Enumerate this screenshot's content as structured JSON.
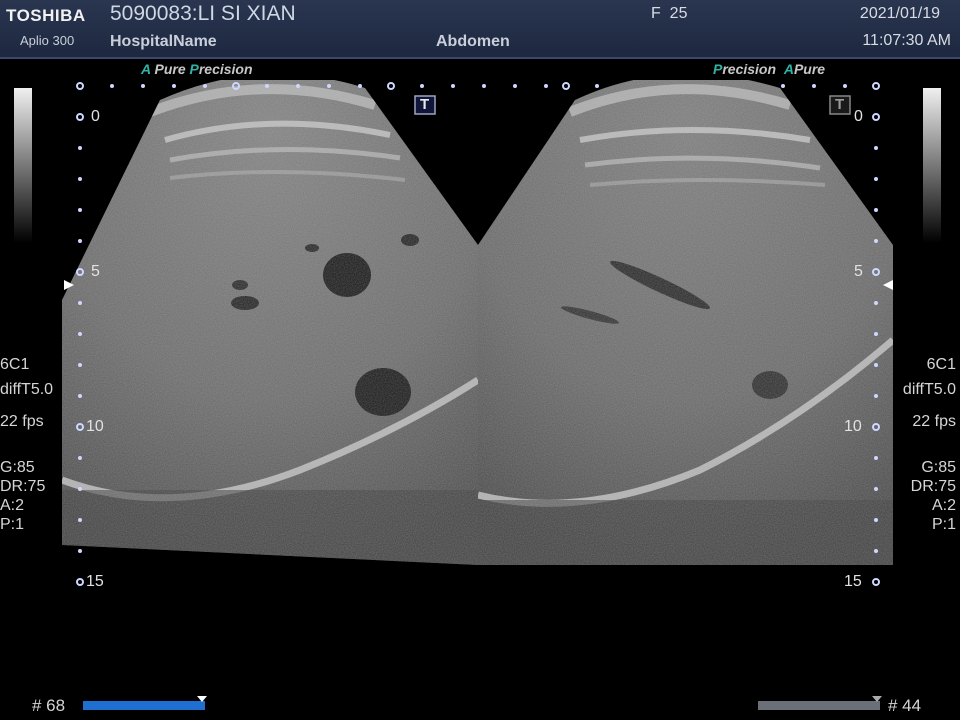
{
  "header": {
    "brand": "TOSHIBA",
    "model": "Aplio 300",
    "patient": "5090083:LI SI XIAN",
    "hospital": "HospitalName",
    "exam": "Abdomen",
    "frame_label": "F",
    "frame_value": "25",
    "date": "2021/01/19",
    "time": "11:07:30 AM"
  },
  "left_image": {
    "tag_a": "A",
    "tag_pure": " Pure ",
    "tag_p": "P",
    "tag_precision": "recision",
    "t_marker": "T",
    "depth_labels": [
      "0",
      "5",
      "10",
      "15"
    ],
    "probe": "6C1",
    "mode": "diffT5.0",
    "fps": "22 fps",
    "gain": "G:85",
    "dynamic_range": "DR:75",
    "a": "A:2",
    "p": "P:1",
    "frame_number": "# 68",
    "cine_progress": 1.0
  },
  "right_image": {
    "tag_p": "P",
    "tag_precision": "recision ",
    "tag_a": "A",
    "tag_pure": "Pure",
    "t_marker": "T",
    "depth_labels": [
      "0",
      "5",
      "10",
      "15"
    ],
    "probe": "6C1",
    "mode": "diffT5.0",
    "fps": "22 fps",
    "gain": "G:85",
    "dynamic_range": "DR:75",
    "a": "A:2",
    "p": "P:1",
    "frame_number": "# 44",
    "cine_progress": 1.0
  },
  "colors": {
    "header_bg": "#1d2740",
    "accent_teal": "#2fb3a7",
    "cine_blue": "#1f6fd0",
    "cine_gray": "#6a6f78"
  },
  "icons": [
    "t-marker-icon",
    "focus-marker-icon",
    "grayscale-bar"
  ]
}
